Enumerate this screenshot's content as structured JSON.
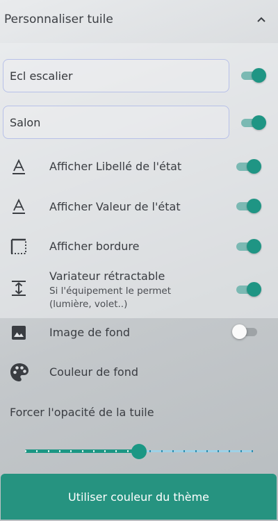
{
  "header": {
    "title": "Personnaliser tuile",
    "collapse_icon": "chevron-up-icon"
  },
  "fields": [
    {
      "value": "Ecl escalier",
      "toggle_on": true
    },
    {
      "value": "Salon",
      "toggle_on": true
    }
  ],
  "options": [
    {
      "icon": "text-format-icon",
      "label": "Afficher Libellé de l'état",
      "toggle_on": true
    },
    {
      "icon": "text-format-icon",
      "label": "Afficher Valeur de l'état",
      "toggle_on": true
    },
    {
      "icon": "border-icon",
      "label": "Afficher bordure",
      "toggle_on": true
    },
    {
      "icon": "vertical-resize-icon",
      "label": "Variateur rétractable",
      "sublabel_1": "Si l'équipement le permet",
      "sublabel_2": "(lumière, volet..)",
      "toggle_on": true
    },
    {
      "icon": "image-icon",
      "label": "Image de fond",
      "toggle_on": false
    },
    {
      "icon": "palette-icon",
      "label": "Couleur de fond"
    }
  ],
  "opacity": {
    "label": "Forcer l'opacité de la tuile",
    "value_fraction": 0.5,
    "steps": 20
  },
  "theme_button": {
    "label": "Utiliser couleur du thème"
  },
  "colors": {
    "accent": "#1f9584",
    "button": "#269380",
    "slider_rail": "#9fd1e6"
  }
}
